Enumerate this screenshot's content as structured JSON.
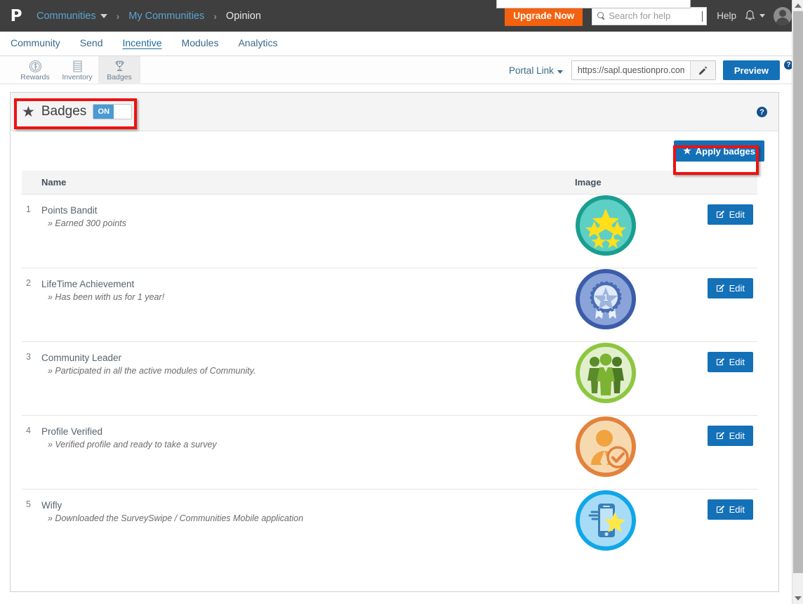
{
  "topbar": {
    "logo": "P",
    "breadcrumbs": [
      {
        "label": "Communities",
        "type": "dropdown"
      },
      {
        "label": "My Communities",
        "type": "link"
      },
      {
        "label": "Opinion",
        "type": "current"
      }
    ],
    "separator": "›",
    "upgrade_label": "Upgrade Now",
    "search_placeholder": "Search for help",
    "search_value": "",
    "help_label": "Help",
    "bell_icon": "bell-icon",
    "avatar_icon": "avatar-icon"
  },
  "nav": {
    "tabs": [
      {
        "label": "Community",
        "active": false
      },
      {
        "label": "Send",
        "active": false
      },
      {
        "label": "Incentive",
        "active": true
      },
      {
        "label": "Modules",
        "active": false
      },
      {
        "label": "Analytics",
        "active": false
      }
    ]
  },
  "subbar": {
    "tabs": [
      {
        "label": "Rewards",
        "icon": "coin-icon",
        "active": false
      },
      {
        "label": "Inventory",
        "icon": "server-icon",
        "active": false
      },
      {
        "label": "Badges",
        "icon": "trophy-icon",
        "active": true
      }
    ],
    "portal_link_label": "Portal Link",
    "url_value": "https://sapl.questionpro.com",
    "url_placeholder": "https://",
    "edit_icon": "pencil-icon",
    "preview_label": "Preview",
    "help_icon": "question-mark-icon"
  },
  "panel": {
    "title": "Badges",
    "title_icon": "star-icon",
    "toggle_state": "ON",
    "help_icon": "question-mark-icon",
    "apply_label": "Apply badges",
    "apply_icon": "star-icon"
  },
  "table": {
    "headers": {
      "num": "",
      "name": "Name",
      "image": "Image",
      "action": ""
    },
    "edit_label": "Edit",
    "edit_icon": "pencil-square-icon",
    "rows": [
      {
        "num": "1",
        "name": "Points Bandit",
        "description": "» Earned 300 points",
        "badge": "five-stars-badge",
        "colors": {
          "ring": "#1a9e8f",
          "fill": "#5ecfc4",
          "accent": "#ffe01b"
        }
      },
      {
        "num": "2",
        "name": "LifeTime Achievement",
        "description": "» Has been with us for 1 year!",
        "badge": "medal-rosette-badge",
        "colors": {
          "ring": "#3b5ca8",
          "fill": "#8aa3d8",
          "accent": "#e8f0fb"
        },
        "medal_number": "1"
      },
      {
        "num": "3",
        "name": "Community Leader",
        "description": "» Participated in all the active modules of Community.",
        "badge": "three-people-badge",
        "colors": {
          "ring": "#8dc63f",
          "fill": "#dcedc0",
          "accent": "#5b8b2a"
        }
      },
      {
        "num": "4",
        "name": "Profile Verified",
        "description": "» Verified profile and ready to take a survey",
        "badge": "verified-person-badge",
        "colors": {
          "ring": "#e2823c",
          "fill": "#f7d2a0",
          "accent": "#f0a33f"
        }
      },
      {
        "num": "5",
        "name": "Wifly",
        "description": "» Downloaded the SurveySwipe / Communities Mobile application",
        "badge": "mobile-star-badge",
        "colors": {
          "ring": "#10a6e8",
          "fill": "#a6dcf7",
          "accent": "#3a7fb5"
        }
      }
    ]
  },
  "annotations": {
    "badges_toggle": "highlight-badges-toggle",
    "apply_button": "highlight-apply-badges"
  },
  "colors": {
    "brand_blue": "#1471b8",
    "orange": "#f4610f",
    "dark_bar": "#3f3f3f",
    "annotation_red": "#ee1111"
  }
}
